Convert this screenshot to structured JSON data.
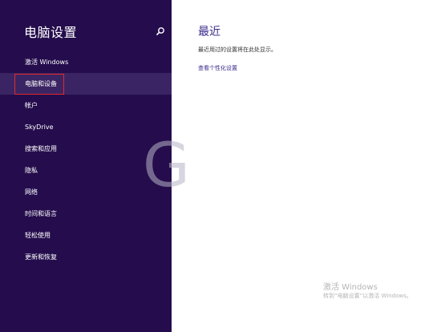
{
  "sidebar": {
    "title": "电脑设置",
    "search_icon": "search-icon",
    "items": [
      {
        "label": "激活 Windows"
      },
      {
        "label": "电脑和设备",
        "selected": true
      },
      {
        "label": "帐户"
      },
      {
        "label": "SkyDrive"
      },
      {
        "label": "搜索和应用"
      },
      {
        "label": "隐私"
      },
      {
        "label": "网络"
      },
      {
        "label": "时间和语言"
      },
      {
        "label": "轻松使用"
      },
      {
        "label": "更新和恢复"
      }
    ]
  },
  "main": {
    "title": "最近",
    "description": "最近用过的设置将在此处显示。",
    "link": "查看个性化设置"
  },
  "activation": {
    "title": "激活 Windows",
    "subtitle": "转到“电脑设置”以激活 Windows。"
  },
  "colors": {
    "sidebar_bg": "#250d4d",
    "selected_bg": "#3b2463",
    "accent": "#3b2a8a",
    "highlight_box": "#e02a2a"
  }
}
